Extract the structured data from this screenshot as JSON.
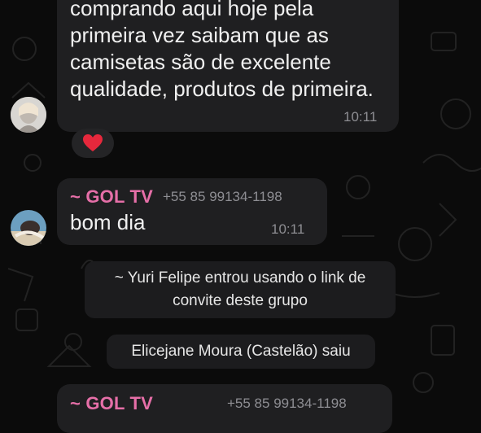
{
  "messages": {
    "first": {
      "text": "comprando aqui hoje pela\nprimeira vez saibam que as\ncamisetas são de excelente\nqualidade, produtos de primeira.",
      "time": "10:11",
      "reaction": "heart-emoji"
    },
    "second": {
      "sender": "~ GOL TV",
      "phone": "+55 85 99134-1198",
      "text": "bom dia",
      "time": "10:11"
    },
    "third": {
      "sender": "~ GOL TV",
      "phone": "+55 85 99134-1198"
    }
  },
  "system": {
    "joined": "~ Yuri Felipe entrou usando o link de\nconvite deste grupo",
    "left": "Elicejane Moura (Castelão) saiu"
  },
  "colors": {
    "background": "#0b0b0b",
    "bubble": "#1f1f21",
    "sender": "#e66fa8",
    "time": "#8e8e93"
  }
}
